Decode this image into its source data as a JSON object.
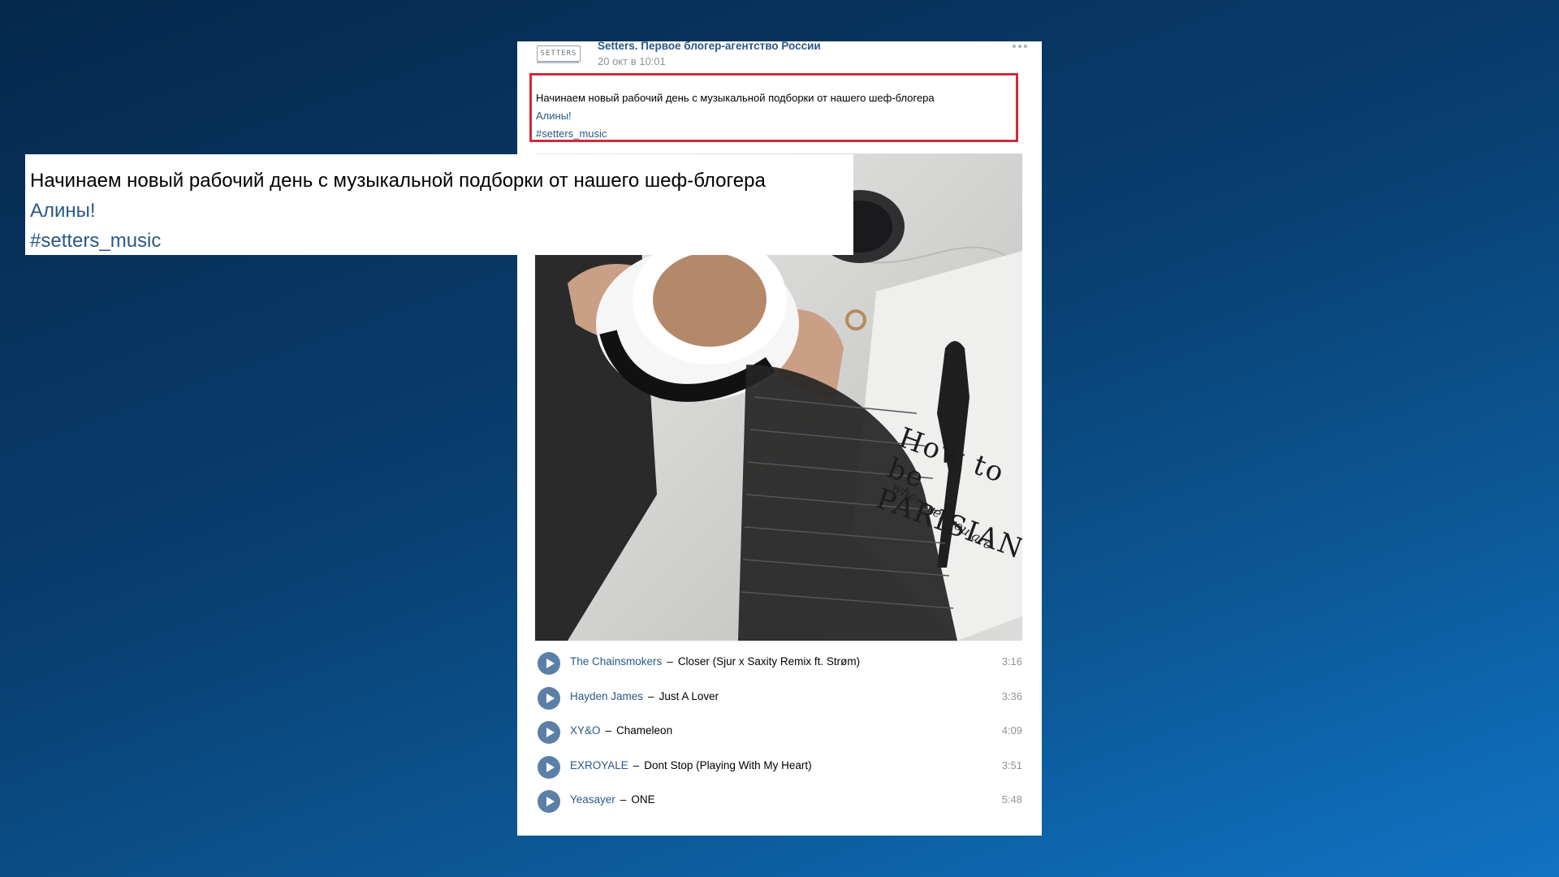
{
  "post": {
    "author": "Setters. Первое блогер-агентство России",
    "date": "20 окт в 10:01",
    "logo_text": "SETTERS",
    "text_line1": "Начинаем новый рабочий день с музыкальной подборки от нашего шеф-блогера",
    "text_line2": "Алины!",
    "hashtag": "#setters_music",
    "book_title": "How to be PARISIAN",
    "book_subtitle": "wherever you are"
  },
  "playlist": [
    {
      "artist": "The Chainsmokers",
      "title": "Closer (Sjur x Saxity Remix ft. Strøm)",
      "duration": "3:16"
    },
    {
      "artist": "Hayden James",
      "title": "Just A Lover",
      "duration": "3:36"
    },
    {
      "artist": "XY&O",
      "title": "Chameleon",
      "duration": "4:09"
    },
    {
      "artist": "EXROYALE",
      "title": "Dont Stop (Playing With My Heart)",
      "duration": "3:51"
    },
    {
      "artist": "Yeasayer",
      "title": "ONE",
      "duration": "5:48"
    }
  ],
  "zoom": {
    "text_line1": "Начинаем новый рабочий день с музыкальной подборки от нашего шеф-блогера",
    "text_line2": "Алины!",
    "hashtag": "#setters_music"
  },
  "colors": {
    "highlight_border": "#d22a38",
    "link": "#2a5885",
    "play_button": "#5b7fa6",
    "background_start": "#05284d",
    "background_end": "#1173c4"
  },
  "icons": [
    "more-icon",
    "play-icon"
  ]
}
